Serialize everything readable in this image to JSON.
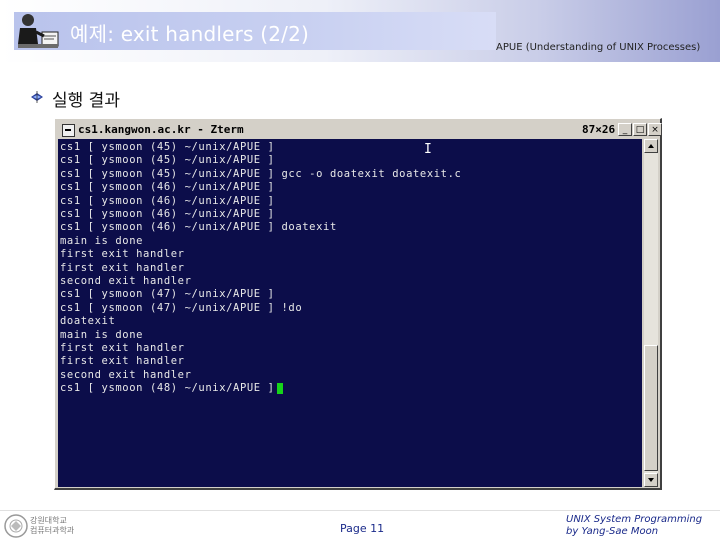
{
  "header": {
    "title": "예제: exit handlers (2/2)",
    "subtitle": "APUE (Understanding of UNIX Processes)",
    "presenter_icon": "presenter-icon"
  },
  "section": {
    "label": "실행 결과",
    "bullet_icon": "bullet-icon"
  },
  "window": {
    "title": "cs1.kangwon.ac.kr - Zterm",
    "size": "87×26",
    "minimize_label": "_",
    "maximize_label": "□",
    "close_label": "×"
  },
  "terminal": {
    "lines": [
      "cs1 [ ysmoon (45) ~/unix/APUE ]",
      "cs1 [ ysmoon (45) ~/unix/APUE ]",
      "cs1 [ ysmoon (45) ~/unix/APUE ] gcc -o doatexit doatexit.c",
      "cs1 [ ysmoon (46) ~/unix/APUE ]",
      "cs1 [ ysmoon (46) ~/unix/APUE ]",
      "cs1 [ ysmoon (46) ~/unix/APUE ]",
      "cs1 [ ysmoon (46) ~/unix/APUE ] doatexit",
      "main is done",
      "first exit handler",
      "first exit handler",
      "second exit handler",
      "cs1 [ ysmoon (47) ~/unix/APUE ]",
      "cs1 [ ysmoon (47) ~/unix/APUE ] !do",
      "doatexit",
      "main is done",
      "first exit handler",
      "first exit handler",
      "second exit handler",
      "cs1 [ ysmoon (48) ~/unix/APUE ] "
    ],
    "bg_color": "#0c0d4a",
    "cursor_color": "#16d41a"
  },
  "footer": {
    "page": "Page 11",
    "right_line1": "UNIX System Programming",
    "right_line2": "by Yang-Sae Moon",
    "logo_line1": "강원대학교",
    "logo_line2": "컴퓨터과학과"
  }
}
